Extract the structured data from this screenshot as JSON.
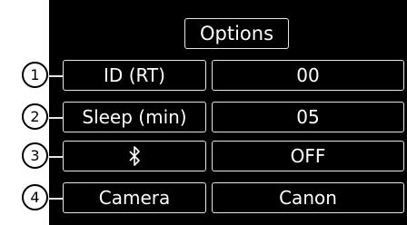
{
  "title": "Options",
  "rows": [
    {
      "number": "1",
      "label": "ID (RT)",
      "value": "00"
    },
    {
      "number": "2",
      "label": "Sleep (min)",
      "value": "05"
    },
    {
      "number": "3",
      "label": "",
      "label_icon": "bluetooth-icon",
      "value": "OFF"
    },
    {
      "number": "4",
      "label": "Camera",
      "value": "Canon"
    }
  ],
  "colors": {
    "screen_background": "#000000",
    "text": "#ffffff",
    "border": "#e6e6e6",
    "callout_fill": "#ffffff",
    "callout_outline": "#000000"
  }
}
